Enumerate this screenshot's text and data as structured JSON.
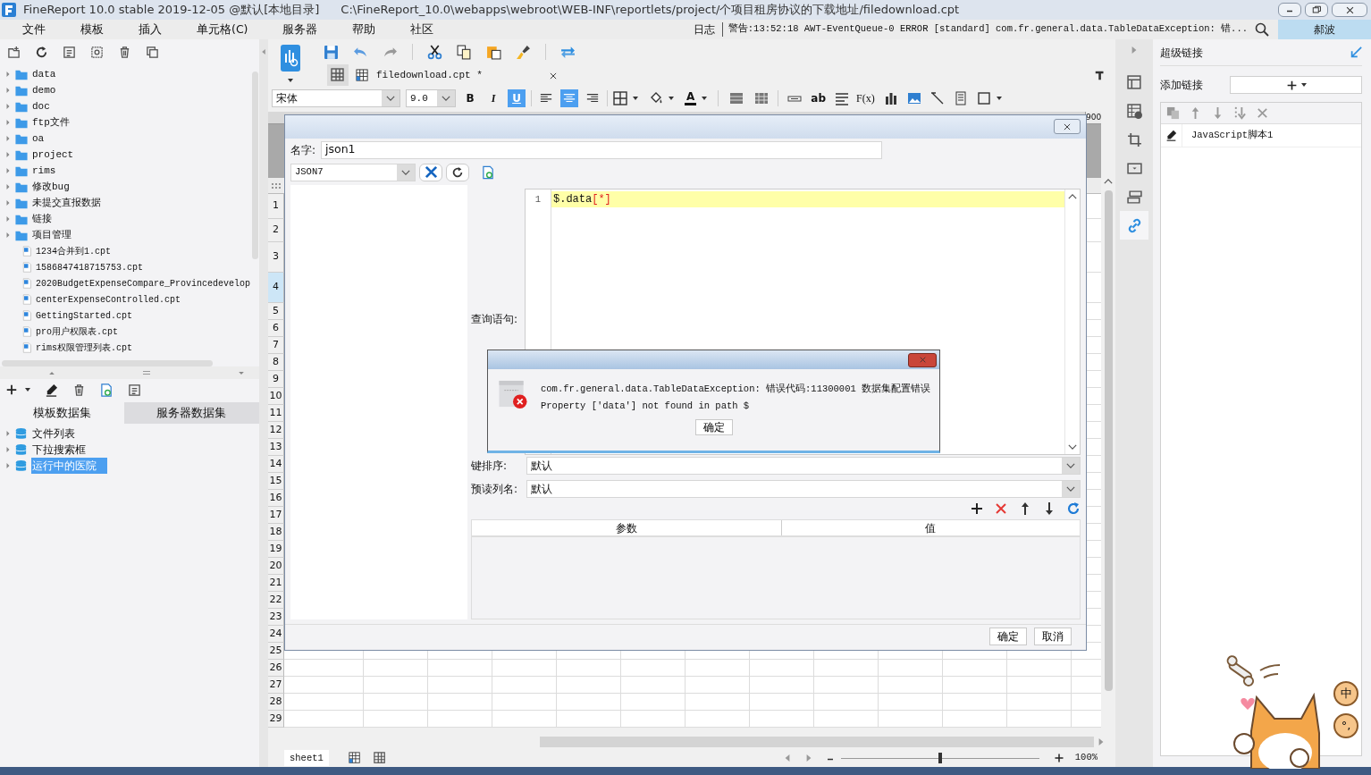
{
  "window": {
    "title": "FineReport 10.0 stable 2019-12-05 @默认[本地目录]",
    "path": "C:\\FineReport_10.0\\webapps\\webroot\\WEB-INF\\reportlets/project/个项目租房协议的下载地址/filedownload.cpt"
  },
  "menu": [
    "文件",
    "模板",
    "插入",
    "单元格(C)",
    "服务器",
    "帮助",
    "社区"
  ],
  "status": {
    "log_label": "日志",
    "message": "警告:13:52:18 AWT-EventQueue-0 ERROR [standard] com.fr.general.data.TableDataException: 错...",
    "user": "郝波"
  },
  "template_tree": [
    {
      "label": "data",
      "kind": "folder"
    },
    {
      "label": "demo",
      "kind": "folder"
    },
    {
      "label": "doc",
      "kind": "folder"
    },
    {
      "label": "ftp文件",
      "kind": "folder"
    },
    {
      "label": "oa",
      "kind": "folder"
    },
    {
      "label": "project",
      "kind": "folder"
    },
    {
      "label": "rims",
      "kind": "folder"
    },
    {
      "label": "修改bug",
      "kind": "folder"
    },
    {
      "label": "未提交直报数据",
      "kind": "folder"
    },
    {
      "label": "链接",
      "kind": "folder"
    },
    {
      "label": "项目管理",
      "kind": "folder"
    },
    {
      "label": "1234合并到1.cpt",
      "kind": "file"
    },
    {
      "label": "1586847418715753.cpt",
      "kind": "file"
    },
    {
      "label": "2020BudgetExpenseCompare_Provincedevelop",
      "kind": "file"
    },
    {
      "label": "centerExpenseControlled.cpt",
      "kind": "file"
    },
    {
      "label": "GettingStarted.cpt",
      "kind": "file"
    },
    {
      "label": "pro用户权限表.cpt",
      "kind": "file"
    },
    {
      "label": "rims权限管理列表.cpt",
      "kind": "file"
    }
  ],
  "dataset_tabs": [
    {
      "label": "模板数据集",
      "selected": true
    },
    {
      "label": "服务器数据集",
      "selected": false
    }
  ],
  "datasets": [
    {
      "label": "文件列表",
      "selected": false
    },
    {
      "label": "下拉搜索框",
      "selected": false
    },
    {
      "label": "运行中的医院",
      "selected": true
    }
  ],
  "editor_tabs": [
    {
      "label": "filedownload.cpt *",
      "selected": true
    }
  ],
  "format": {
    "font": "宋体",
    "size": "9.0",
    "styles": [
      {
        "label": "B",
        "on": false
      },
      {
        "label": "I",
        "on": false
      },
      {
        "label": "U",
        "on": true
      }
    ],
    "align": [
      {
        "kind": "left",
        "on": false
      },
      {
        "kind": "center",
        "on": true
      },
      {
        "kind": "right",
        "on": false
      }
    ],
    "font_color": "A",
    "text_tools": [
      "ab",
      "F(x)"
    ]
  },
  "sheet": {
    "column_label": "900",
    "rows": [
      {
        "label": "1",
        "selected": false
      },
      {
        "label": "2",
        "selected": false
      },
      {
        "label": "3",
        "selected": false
      },
      {
        "label": "4",
        "selected": true
      },
      {
        "label": "5",
        "selected": false
      },
      {
        "label": "6",
        "selected": false
      },
      {
        "label": "7",
        "selected": false
      },
      {
        "label": "8",
        "selected": false
      },
      {
        "label": "9",
        "selected": false
      },
      {
        "label": "10",
        "selected": false
      },
      {
        "label": "11",
        "selected": false
      },
      {
        "label": "12",
        "selected": false
      },
      {
        "label": "13",
        "selected": false
      },
      {
        "label": "14",
        "selected": false
      },
      {
        "label": "15",
        "selected": false
      },
      {
        "label": "16",
        "selected": false
      },
      {
        "label": "17",
        "selected": false
      },
      {
        "label": "18",
        "selected": false
      },
      {
        "label": "19",
        "selected": false
      },
      {
        "label": "20",
        "selected": false
      },
      {
        "label": "21",
        "selected": false
      },
      {
        "label": "22",
        "selected": false
      },
      {
        "label": "23",
        "selected": false
      },
      {
        "label": "24",
        "selected": false
      },
      {
        "label": "25",
        "selected": false
      },
      {
        "label": "26",
        "selected": false
      },
      {
        "label": "27",
        "selected": false
      },
      {
        "label": "28",
        "selected": false
      },
      {
        "label": "29",
        "selected": false
      }
    ]
  },
  "sheet_tabs": [
    {
      "label": "sheet1",
      "selected": true
    }
  ],
  "zoom": {
    "label": "100%",
    "level": 0.5
  },
  "dialog": {
    "name_label": "名字:",
    "name": "json1",
    "source": "JSON7",
    "query_label": "查询语句:",
    "query_lines": [
      {
        "number": "1",
        "code": "$.data",
        "selector": "[*]"
      }
    ],
    "sort_label": "键排序:",
    "sort": "默认",
    "preview_label": "预读列名:",
    "preview": "默认",
    "param_columns": [
      "参数",
      "值"
    ],
    "buttons": [
      "确定",
      "取消"
    ]
  },
  "error": {
    "message": "com.fr.general.data.TableDataException: 错误代码:11300001 数据集配置错误",
    "detail": "Property ['data'] not found in path $",
    "button": "确定"
  },
  "side_tabs": [
    {
      "selected": false
    },
    {
      "selected": false
    },
    {
      "selected": false
    },
    {
      "selected": false
    },
    {
      "selected": false
    },
    {
      "selected": true
    }
  ],
  "hyperlink": {
    "title": "超级链接",
    "add_label": "添加链接",
    "items": [
      {
        "label": "JavaScript脚本1"
      }
    ]
  },
  "ime": [
    "中",
    "°,"
  ]
}
